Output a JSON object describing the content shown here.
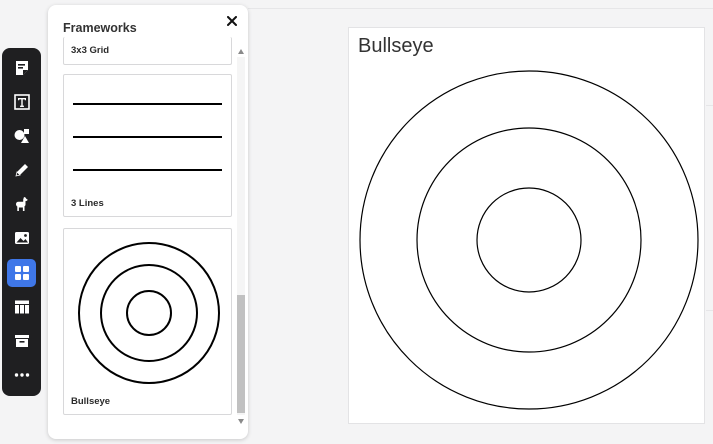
{
  "panel": {
    "title": "Frameworks",
    "cards": [
      {
        "label": "3x3 Grid"
      },
      {
        "label": "3 Lines"
      },
      {
        "label": "Bullseye"
      }
    ]
  },
  "board": {
    "title": "Bullseye"
  },
  "toolbar": {
    "tools": [
      "sticky-note-icon",
      "text-icon",
      "shapes-icon",
      "pencil-icon",
      "llama-icon",
      "image-icon",
      "frameworks-icon",
      "table-icon",
      "archive-icon",
      "more-icon"
    ],
    "active_tool": "frameworks-icon"
  },
  "colors": {
    "toolbar_bg": "#1f1f21",
    "active_tool_bg": "#3f77e8",
    "line": "#000000"
  }
}
